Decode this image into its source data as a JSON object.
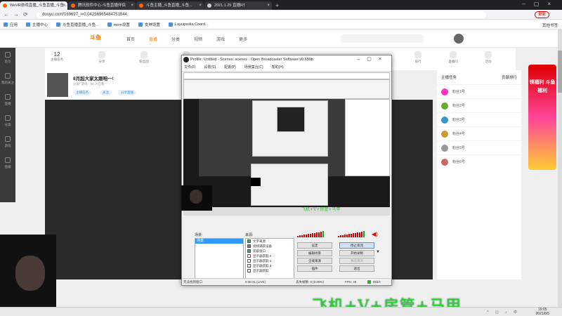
{
  "browser": {
    "tabs": [
      {
        "label": "WeVR游戏直播_斗鱼直播_斗鱼...",
        "active": true
      },
      {
        "label": "腾讯软件中心-斗鱼直播伴侣",
        "active": false
      },
      {
        "label": "斗鱼主播_斗鱼直播_斗鱼...",
        "active": false
      },
      {
        "label": "2021.1.25 直播RT",
        "active": false
      }
    ],
    "url": "douyu.com/169697_i=0.04256965484751844",
    "profile_label": "更新",
    "bookmarks": [
      "应用",
      "主播中心",
      "斗鱼直播直播_斗鱼...",
      "mem设置",
      "女神设置",
      "Layuipedia Coord..."
    ],
    "other_bookmarks": "其他书签"
  },
  "site": {
    "logo": "斗鱼",
    "nav": [
      "首页",
      "直播",
      "分类",
      "视频",
      "游戏",
      "更多"
    ],
    "nav_active": 1,
    "left_nav": [
      "首页",
      "我的关注",
      "直播",
      "分类",
      "游戏",
      "直播"
    ],
    "strip_items": [
      "12",
      "主播任务",
      "分享",
      "粉丝团",
      "贡献值",
      "排行",
      "直播间",
      "活动"
    ],
    "room_title": "8月起大家太跟咱一!",
    "room_sub": "分类: 游戏 · 99 人在看",
    "room_tags": [
      "主播任务",
      "关注",
      "分享直播"
    ],
    "chat_header": [
      "主播任务",
      "贡献排行"
    ],
    "rank_rows": [
      "粉丝1号",
      "粉丝2号",
      "粉丝3号",
      "粉丝4号",
      "粉丝5号",
      "粉丝6号"
    ],
    "promo_text": "领福利 斗鱼福利"
  },
  "obs": {
    "title": "Profile: Untitled - Scenes: scenes - Open Broadcaster Software v0.659b",
    "menu": [
      "文件(F)",
      "设置(S)",
      "配置(P)",
      "场景集合(C)",
      "帮助(H)"
    ],
    "scenes_label": "场景:",
    "scenes": [
      "场景"
    ],
    "sources_label": "来源:",
    "sources": [
      {
        "name": "文字来源",
        "on": true
      },
      {
        "name": "视频捕获设备",
        "on": true
      },
      {
        "name": "获取窗口",
        "on": true
      },
      {
        "name": "显示器获取 4",
        "on": false
      },
      {
        "name": "显示器获取 4",
        "on": false
      },
      {
        "name": "显示器获取 3",
        "on": false
      },
      {
        "name": "显示器获取",
        "on": false
      }
    ],
    "buttons": [
      "设定",
      "停止串流",
      "编辑场景",
      "开始录制",
      "全域来源",
      "预览串流",
      "插件",
      "退出"
    ],
    "preview_watermark": "飞机+V+房管+马甲",
    "status": {
      "left": "无法找到窗口",
      "time": "0:30:31 (LIVE)",
      "dropped": "丢失帧数: 0 (0.00%)",
      "fps": "FPS: 49",
      "bitrate": "0kb/s"
    }
  },
  "overlay_watermark": "飞机+V+房管+马甲",
  "taskbar": {
    "time": "19:05",
    "date": "2021/8/5"
  }
}
